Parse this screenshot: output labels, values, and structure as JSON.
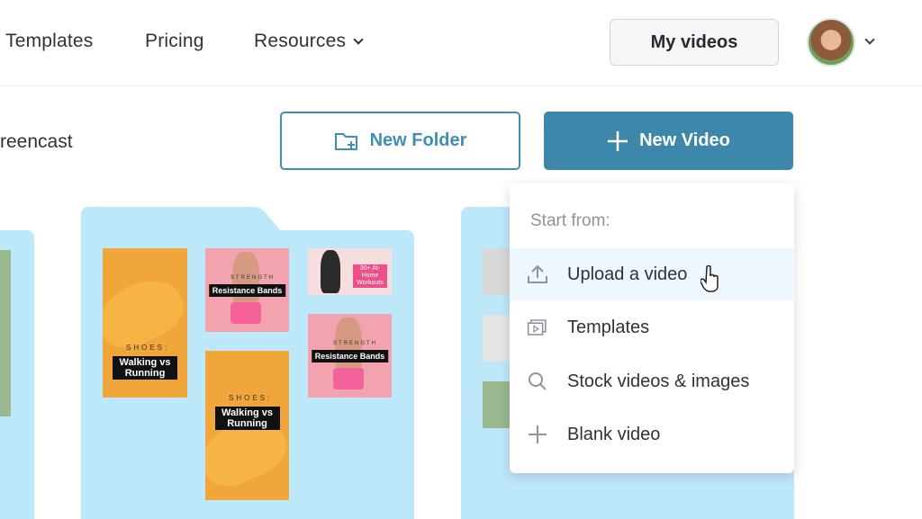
{
  "nav": {
    "templates": "Templates",
    "pricing": "Pricing",
    "resources": "Resources",
    "my_videos": "My videos"
  },
  "toolbar": {
    "screencast_partial": "reencast",
    "new_folder": "New Folder",
    "new_video": "New Video"
  },
  "thumbnails": {
    "walking_a": "Walking vs Running",
    "walking_b": "Walking vs Running",
    "shoes_label_a": "SHOES:",
    "shoes_label_b": "SHOES:",
    "bands_a": "Resistance Bands",
    "bands_b": "Resistance Bands",
    "strength_a": "STRENGTH",
    "strength_b": "STRENGTH",
    "home_workouts": "30+ At-Home Workouts"
  },
  "dropdown": {
    "header": "Start from:",
    "items": [
      {
        "label": "Upload a video",
        "icon": "upload-icon"
      },
      {
        "label": "Templates",
        "icon": "templates-icon"
      },
      {
        "label": "Stock videos & images",
        "icon": "search-icon"
      },
      {
        "label": "Blank video",
        "icon": "plus-icon"
      }
    ]
  },
  "colors": {
    "accent": "#3c87aa",
    "folder": "#bde8fa",
    "hover": "#eef7fd"
  }
}
